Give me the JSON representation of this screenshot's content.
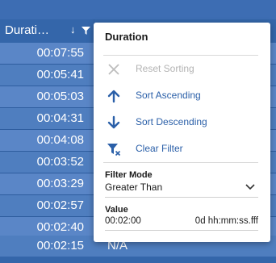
{
  "grid": {
    "column_title": "Durati…",
    "sort_indicator": "↓",
    "rows": [
      {
        "duration": "00:07:55",
        "col2": ""
      },
      {
        "duration": "00:05:41",
        "col2": ""
      },
      {
        "duration": "00:05:03",
        "col2": ""
      },
      {
        "duration": "00:04:31",
        "col2": ""
      },
      {
        "duration": "00:04:08",
        "col2": ""
      },
      {
        "duration": "00:03:52",
        "col2": ""
      },
      {
        "duration": "00:03:29",
        "col2": ""
      },
      {
        "duration": "00:02:57",
        "col2": ""
      },
      {
        "duration": "00:02:40",
        "col2": ""
      },
      {
        "duration": "00:02:15",
        "col2": "N/A"
      }
    ]
  },
  "popup": {
    "title": "Duration",
    "menu": [
      {
        "label": "Reset Sorting",
        "icon": "close-icon",
        "disabled": true
      },
      {
        "label": "Sort Ascending",
        "icon": "arrow-up-icon",
        "disabled": false
      },
      {
        "label": "Sort Descending",
        "icon": "arrow-down-icon",
        "disabled": false
      },
      {
        "label": "Clear Filter",
        "icon": "clear-filter-icon",
        "disabled": false
      }
    ],
    "filter_mode_label": "Filter Mode",
    "filter_mode_value": "Greater Than",
    "value_label": "Value",
    "value": "00:02:00",
    "value_format": "0d hh:mm:ss.fff"
  },
  "colors": {
    "accent": "#2a5fa8",
    "grid_header": "#3466aa",
    "row_odd": "#5a86c7",
    "row_even": "#4f7ebf"
  }
}
